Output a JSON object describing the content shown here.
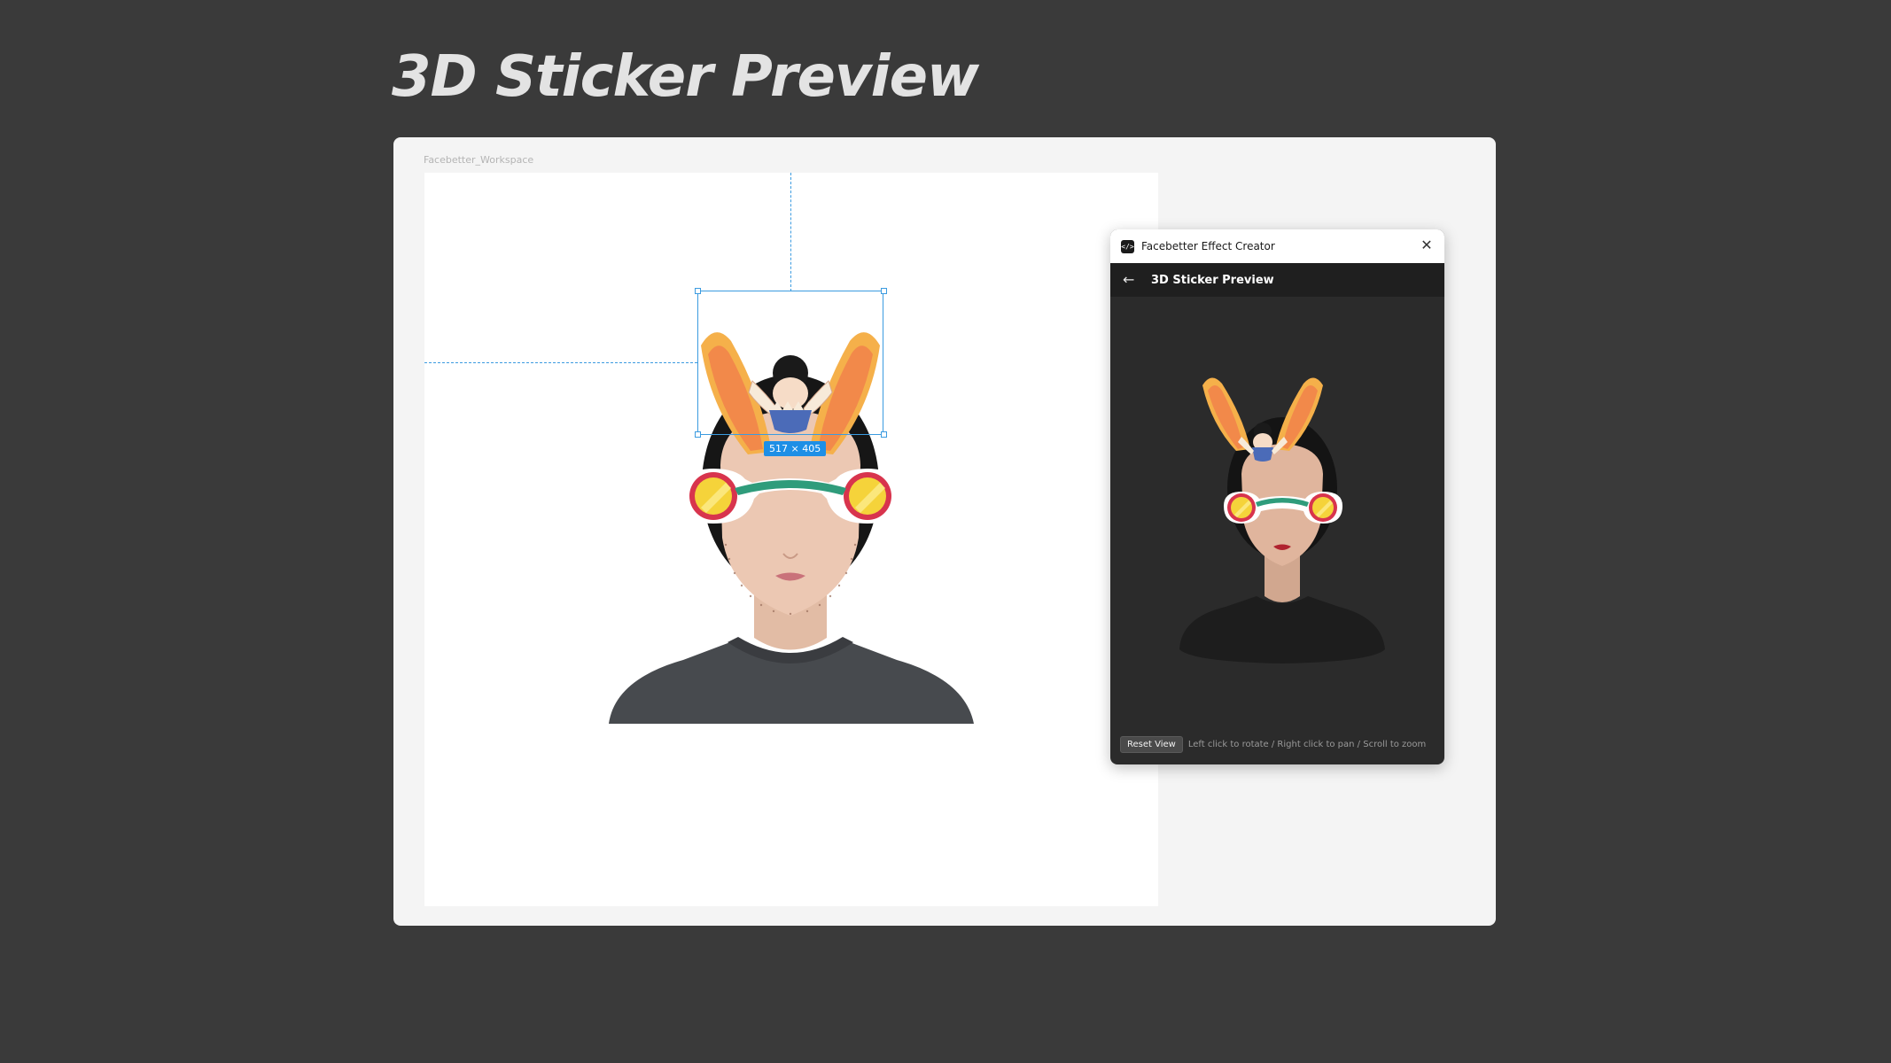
{
  "page": {
    "title": "3D Sticker Preview"
  },
  "workspace": {
    "frame_label": "Facebetter_Workspace",
    "selection_dimensions": "517 × 405"
  },
  "panel": {
    "app_name": "Facebetter Effect Creator",
    "heading": "3D Sticker Preview",
    "reset_label": "Reset View",
    "hint": "Left click to rotate / Right click to pan / Scroll to zoom"
  },
  "colors": {
    "background": "#3a3a3a",
    "selection": "#3b9be0",
    "badge": "#1e8fe6",
    "ear_outer": "#f5b04a",
    "ear_inner": "#f2894a",
    "glasses_frame": "#d8344d",
    "glasses_lens": "#f5d33a"
  }
}
